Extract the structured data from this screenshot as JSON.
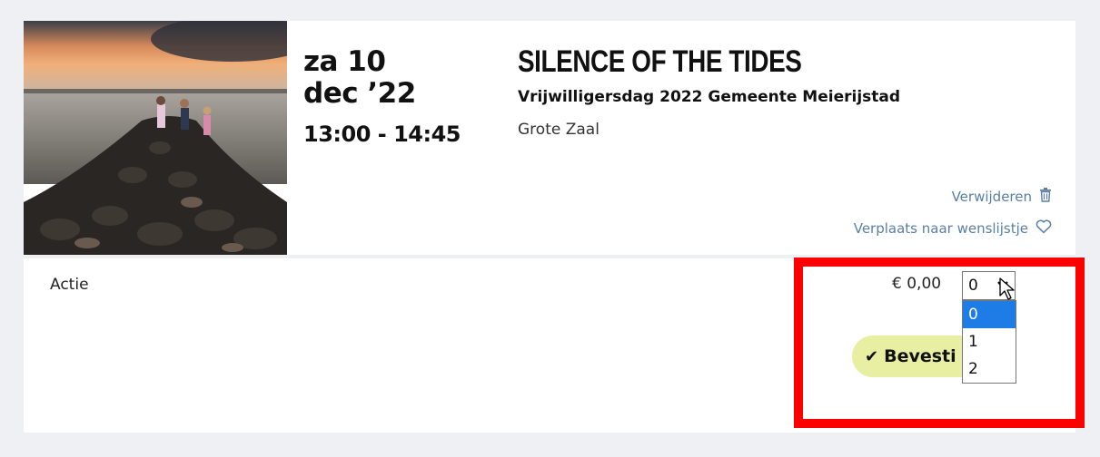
{
  "event": {
    "date_line1": "za 10",
    "date_line2": "dec ’22",
    "time": "13:00 - 14:45",
    "title": "SILENCE OF THE TIDES",
    "subtitle": "Vrijwilligersdag 2022 Gemeente Meierijstad",
    "venue": "Grote Zaal",
    "image_icon": "event-photo-children-on-breakwater"
  },
  "actions": {
    "remove_label": "Verwijderen",
    "remove_icon": "trash-icon",
    "wishlist_label": "Verplaats naar wenslijstje",
    "wishlist_icon": "heart-icon"
  },
  "ticket": {
    "label": "Actie",
    "price": "€ 0,00",
    "quantity_selected": "0",
    "quantity_options": [
      "0",
      "1",
      "2"
    ],
    "confirm_label": "Bevesti",
    "confirm_icon": "checkmark-icon"
  },
  "colors": {
    "background": "#eef0f3",
    "link": "#5a7fa6",
    "confirm_button": "#e8eea2",
    "dropdown_selected": "#1e7ce6",
    "highlight": "#ff0000"
  }
}
